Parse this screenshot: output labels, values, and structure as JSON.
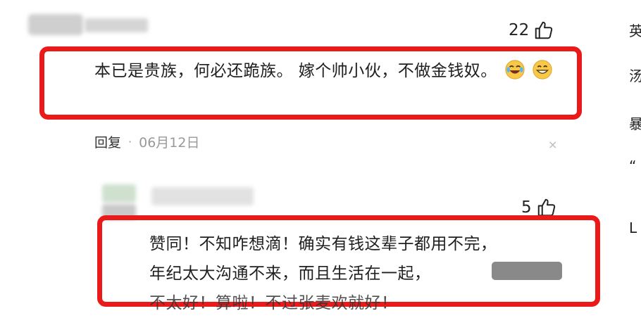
{
  "comment1": {
    "likes": "22",
    "text": "本已是贵族，何必还跪族。 嫁个帅小伙，不做金钱奴。",
    "reply_label": "回复",
    "separator": "·",
    "date": "06月12日",
    "close_glyph": "×"
  },
  "comment2": {
    "likes": "5",
    "line1": "赞同！不知咋想滴！确实有钱这辈子都用不完，",
    "line2": "年纪太大沟通不来，而且生活在一起，",
    "line3": "不太好！算啦！不过张麦欢就好！"
  },
  "right_edge_chars": [
    "英",
    "汤",
    "暴",
    "“",
    "L"
  ],
  "colors": {
    "highlight_frame": "#ea1a1a",
    "date_gray": "#999999",
    "emoji_yellow": "#f7c948"
  },
  "icons": {
    "like": "thumbs-up-icon",
    "emoji_laughing_crying": "laughing-crying-emoji-icon",
    "emoji_grin": "grinning-emoji-icon",
    "close": "close-icon"
  }
}
